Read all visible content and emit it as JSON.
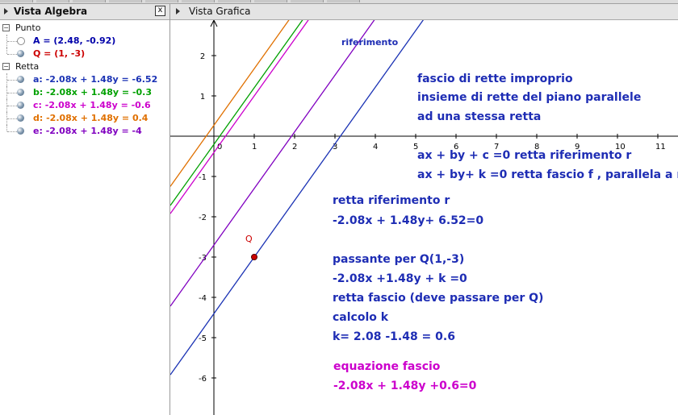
{
  "algebra": {
    "title": "Vista Algebra",
    "close_label": "x",
    "groups": [
      {
        "label": "Punto",
        "items": [
          {
            "text": "A = (2.48, -0.92)",
            "color": "#0000aa",
            "shown": false
          },
          {
            "text": "Q = (1, -3)",
            "color": "#cc0000",
            "shown": true
          }
        ]
      },
      {
        "label": "Retta",
        "items": [
          {
            "text": "a: -2.08x + 1.48y = -6.52",
            "color": "#1a32b4",
            "shown": true
          },
          {
            "text": "b: -2.08x + 1.48y = -0.3",
            "color": "#00a000",
            "shown": true
          },
          {
            "text": "c: -2.08x + 1.48y = -0.6",
            "color": "#cc00cc",
            "shown": true
          },
          {
            "text": "d: -2.08x + 1.48y = 0.4",
            "color": "#e07000",
            "shown": true
          },
          {
            "text": "e: -2.08x + 1.48y = -4",
            "color": "#8000c0",
            "shown": true
          }
        ]
      }
    ]
  },
  "graphics": {
    "title": "Vista Grafica",
    "x_ticks": [
      "0",
      "1",
      "2",
      "3",
      "4",
      "5",
      "6",
      "7",
      "8",
      "9",
      "10",
      "11"
    ],
    "y_ticks": [
      "2",
      "1",
      "-1",
      "-2",
      "-3",
      "-4",
      "-5",
      "-6"
    ],
    "point_label": "Q",
    "point": {
      "x": 1,
      "y": -3
    },
    "lines": [
      {
        "name": "a",
        "k": -6.52,
        "color": "#1a32b4"
      },
      {
        "name": "b",
        "k": -0.3,
        "color": "#00a000"
      },
      {
        "name": "c",
        "k": -0.6,
        "color": "#cc00cc"
      },
      {
        "name": "d",
        "k": 0.4,
        "color": "#e07000"
      },
      {
        "name": "e",
        "k": -4,
        "color": "#8000c0"
      }
    ],
    "ref_label": "riferimento",
    "text_blue_1": "fascio di rette improprio",
    "text_blue_2": "insieme di rette del piano parallele",
    "text_blue_3": "ad una stessa  retta",
    "text_eq_1": "ax + by +  c =0  retta riferimento r",
    "text_eq_2": "ax + by+ k =0    retta fascio f , parallela a r",
    "text_r_title": "retta riferimento r",
    "text_r_eq": "-2.08x + 1.48y+ 6.52=0",
    "text_pass_1": "passante per Q(1,-3)",
    "text_pass_2": "-2.08x +1.48y + k =0",
    "text_pass_3": "retta fascio (deve passare per Q)",
    "text_calc": "calcolo k",
    "text_k": "k= 2.08 -1.48 = 0.6",
    "text_eqf_title": "equazione fascio",
    "text_eqf": "-2.08x + 1.48y +0.6=0",
    "accent_magenta": "#cc00cc",
    "accent_blue": "#1e2db4"
  }
}
